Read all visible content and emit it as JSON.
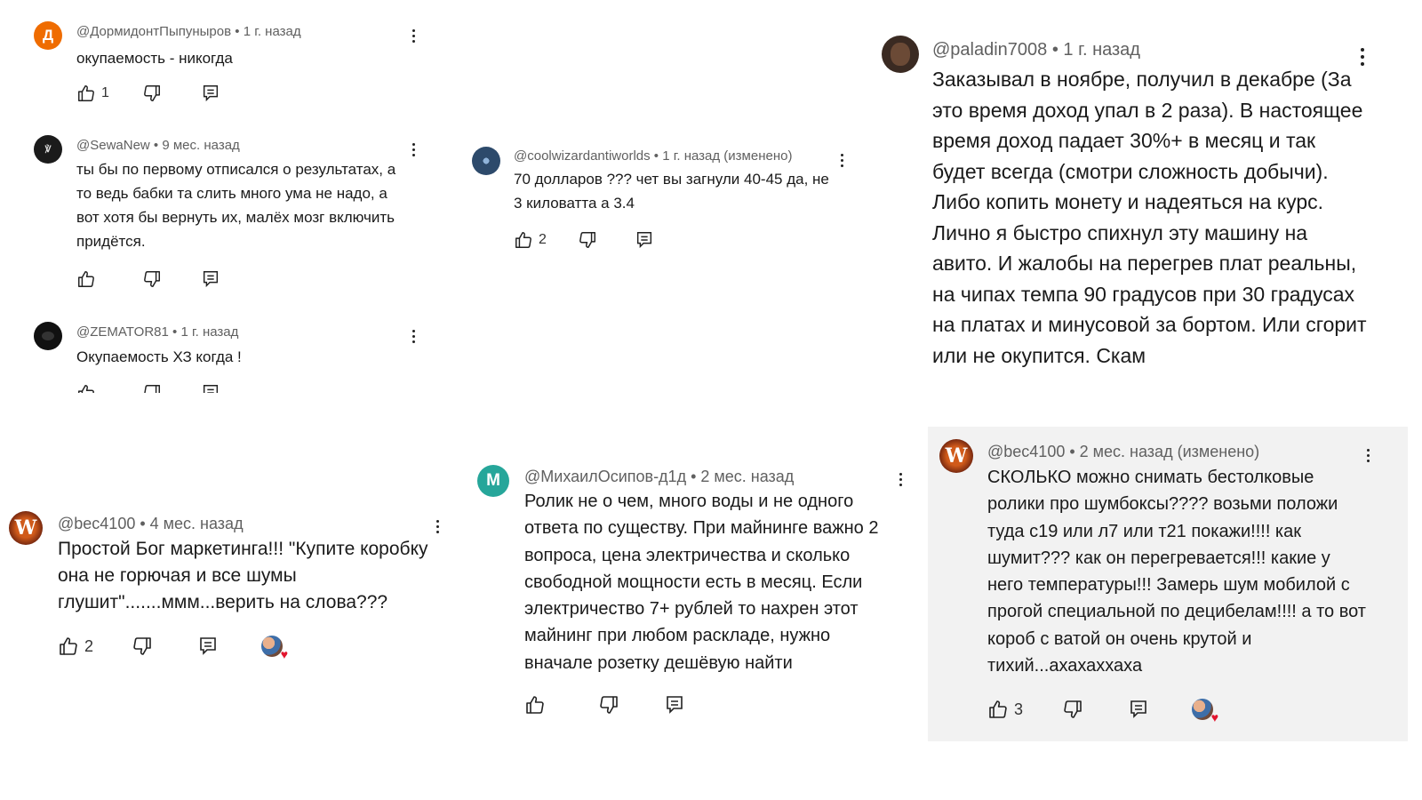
{
  "comments": [
    {
      "handle": "@ДормидонтПыпуныров",
      "time": "1 г. назад",
      "text": "окупаемость - никогда",
      "likes": "1",
      "avatar_letter": "Д",
      "avatar_color": "#ef6c00",
      "avatar_icon": "letter-avatar"
    },
    {
      "handle": "@SewaNew",
      "time": "9 мес. назад",
      "text": "ты бы по первому отписался о результатах, а то ведь бабки та слить много ума не надо, а вот хотя бы вернуть их, малёх мозг включить придётся.",
      "likes": "",
      "avatar_color": "#1b1b1b",
      "avatar_icon": "dark-logo-avatar"
    },
    {
      "handle": "@ZEMATOR81",
      "time": "1 г. назад",
      "text": "Окупаемость ХЗ когда !",
      "likes": "",
      "avatar_color": "#111111",
      "avatar_icon": "dark-photo-avatar"
    },
    {
      "handle": "@coolwizardantiworlds",
      "time": "1 г. назад (изменено)",
      "text": "70 долларов ??? чет вы загнули 40-45 да, не 3 киловатта а 3.4",
      "likes": "2",
      "avatar_color": "#2d4a6b",
      "avatar_icon": "blue-art-avatar"
    },
    {
      "handle": "@paladin7008",
      "time": "1 г. назад",
      "text": "Заказывал в ноябре, получил в декабре (За это время доход упал в 2 раза). В настоящее время доход падает 30%+ в месяц и так будет всегда (смотри сложность добычи). Либо копить монету и надеяться на курс. Лично я быстро спихнул эту машину на авито.  И жалобы на перегрев плат реальны, на чипах темпа 90 градусов при 30 градусах на платах и минусовой за бортом. Или сгорит или не окупится. Скам",
      "likes": "",
      "avatar_color": "#3a2a22",
      "avatar_icon": "person-photo-avatar"
    },
    {
      "handle": "@bec4100",
      "time": "4 мес. назад",
      "text": "Простой Бог маркетинга!!! \"Купите коробку она не горючая и все шумы глушит\".......ммм...верить на слова???",
      "likes": "2",
      "avatar_letter": "W",
      "avatar_color": "#7a2a10",
      "avatar_icon": "w-logo-avatar",
      "creator_heart": true
    },
    {
      "handle": "@МихаилОсипов-д1д",
      "time": "2 мес. назад",
      "text": "Ролик не о чем, много воды и не одного ответа по существу. При майнинге важно 2 вопроса, цена электричества и сколько свободной мощности есть в месяц. Если электричество 7+ рублей то нахрен этот майнинг при любом раскладе, нужно вначале розетку дешёвую найти",
      "likes": "",
      "avatar_letter": "М",
      "avatar_color": "#26a69a",
      "avatar_icon": "letter-avatar"
    },
    {
      "handle": "@bec4100",
      "time": "2 мес. назад (изменено)",
      "text": "СКОЛЬКО можно снимать бестолковые ролики про шумбоксы???? возьми положи туда с19 или л7 или т21 покажи!!!! как шумит??? как он перегревается!!! какие у него температуры!!! Замерь шум мобилой с прогой специальной по децибелам!!!!  а то  вот короб с ватой он очень крутой и тихий...ахахаххаха",
      "likes": "3",
      "avatar_letter": "W",
      "avatar_color": "#7a2a10",
      "avatar_icon": "w-logo-avatar",
      "creator_heart": true
    }
  ],
  "icons": {
    "like": "thumbs-up-icon",
    "dislike": "thumbs-down-icon",
    "reply": "reply-icon",
    "more": "more-vert-icon",
    "heart": "heart-icon"
  },
  "colors": {
    "meta_text": "#606060",
    "body_text": "#1a1a1a",
    "heart": "#e2142d",
    "panel_gray": "#f2f2f2"
  },
  "separator": " • "
}
